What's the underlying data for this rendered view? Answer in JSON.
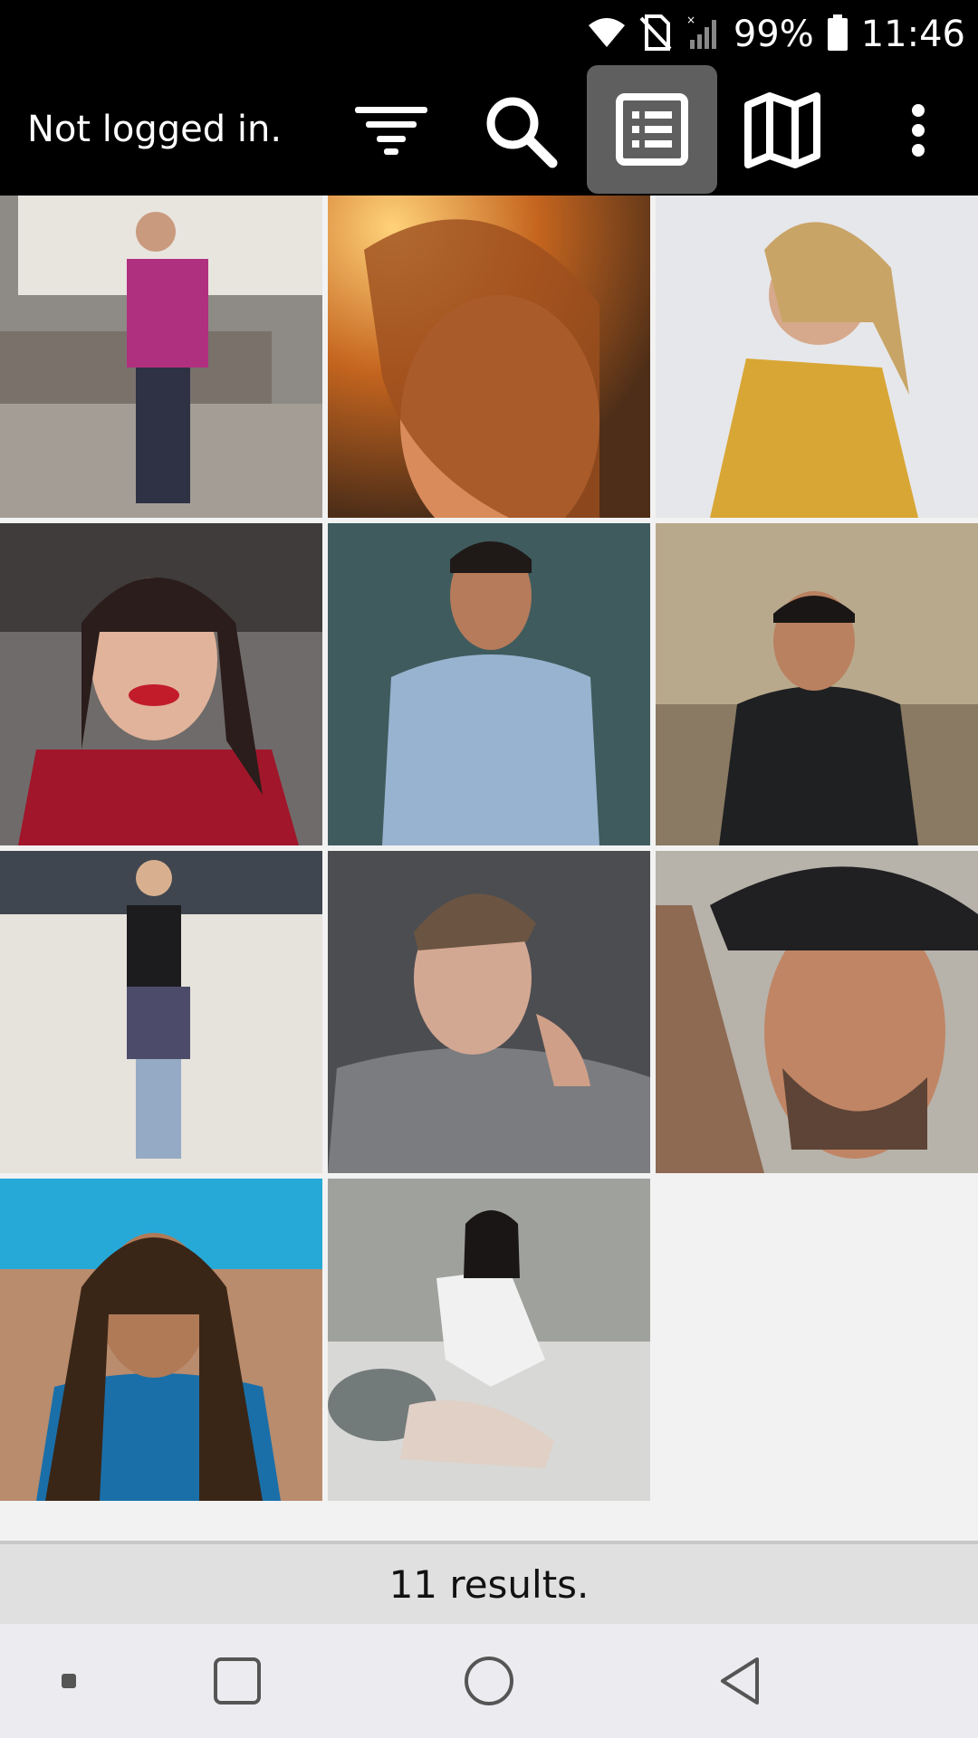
{
  "status_bar": {
    "battery": "99%",
    "time": "11:46",
    "icons": [
      "wifi-icon",
      "no-sim-icon",
      "signal-icon",
      "battery-icon"
    ]
  },
  "toolbar": {
    "title": "Not logged in.",
    "actions": [
      "filter-icon",
      "search-icon",
      "list-view-icon",
      "map-icon",
      "more-vert-icon"
    ],
    "active_action": "list-view-icon"
  },
  "grid": {
    "photos": [
      {
        "label": "photo-1"
      },
      {
        "label": "photo-2"
      },
      {
        "label": "photo-3"
      },
      {
        "label": "photo-4"
      },
      {
        "label": "photo-5"
      },
      {
        "label": "photo-6"
      },
      {
        "label": "photo-7"
      },
      {
        "label": "photo-8"
      },
      {
        "label": "photo-9"
      },
      {
        "label": "photo-10"
      },
      {
        "label": "photo-11"
      }
    ]
  },
  "footer": {
    "results": "11 results."
  },
  "nav_bar": {
    "buttons": [
      "dot-icon",
      "recents-icon",
      "home-icon",
      "back-icon"
    ]
  },
  "colors": {
    "toolbar_bg": "#000000",
    "active_button_bg": "#5f5f5f",
    "content_bg": "#f2f2f2",
    "results_bg": "#e0e0e0",
    "nav_bg": "#ececf0"
  }
}
